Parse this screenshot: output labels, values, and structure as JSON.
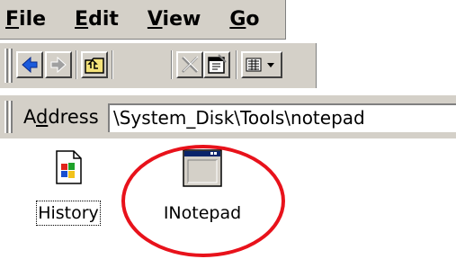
{
  "menu": {
    "items": [
      {
        "label": "File",
        "underline": "F",
        "rest": "ile"
      },
      {
        "label": "Edit",
        "underline": "E",
        "rest": "dit"
      },
      {
        "label": "View",
        "underline": "V",
        "rest": "iew"
      },
      {
        "label": "Go",
        "underline": "G",
        "rest": "o"
      }
    ]
  },
  "toolbar": {
    "buttons": [
      {
        "name": "back-button",
        "icon": "back-arrow-icon"
      },
      {
        "name": "forward-button",
        "icon": "forward-arrow-icon"
      },
      {
        "name": "up-folder-button",
        "icon": "up-folder-icon"
      },
      {
        "name": "delete-button",
        "icon": "delete-x-icon"
      },
      {
        "name": "properties-button",
        "icon": "properties-icon"
      },
      {
        "name": "views-button",
        "icon": "details-view-icon"
      }
    ]
  },
  "address": {
    "label": "Address",
    "underline": "d",
    "value": "\\System_Disk\\Tools\\notepad"
  },
  "files": [
    {
      "label": "History",
      "icon": "windows-document-icon"
    },
    {
      "label": "INotepad",
      "icon": "application-window-icon"
    }
  ],
  "colors": {
    "chrome": "#d4d0c8",
    "highlight_ring": "#e8121b",
    "window_titlebar": "#0a246a"
  }
}
